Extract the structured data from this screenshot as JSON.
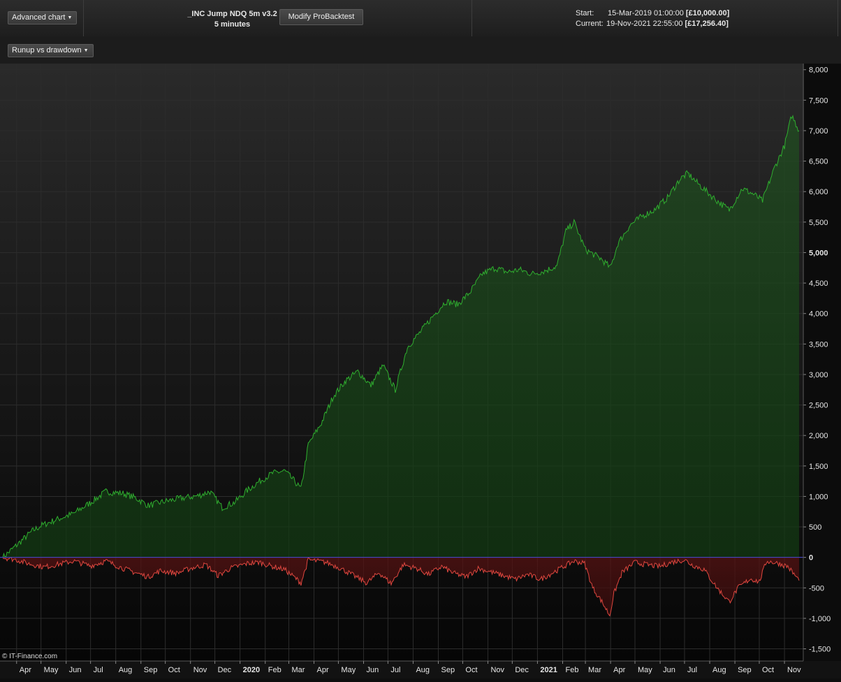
{
  "toolbar": {
    "advanced_chart_label": "Advanced chart",
    "strategy_name": "_INC Jump NDQ 5m v3.2",
    "timeframe": "5 minutes",
    "modify_button": "Modify ProBacktest",
    "start_label": "Start:",
    "start_datetime": "15-Mar-2019 01:00:00",
    "start_capital": "[£10,000.00]",
    "current_label": "Current:",
    "current_datetime": "19-Nov-2021 22:55:00",
    "current_capital": "[£17,256.40]",
    "view_selector": "Runup vs drawdown"
  },
  "footer": {
    "credit": "© IT-Finance.com"
  },
  "colors": {
    "runup": "#2fae2f",
    "drawdown": "#e0473f",
    "zero_line": "#4a4ad8",
    "grid": "#2c2c2c"
  },
  "chart_data": {
    "type": "area",
    "title": "",
    "ylim": [
      -1700,
      8100
    ],
    "y_ticks": [
      "8,000",
      "7,500",
      "7,000",
      "6,500",
      "6,000",
      "5,500",
      "5,000",
      "4,500",
      "4,000",
      "3,500",
      "3,000",
      "2,500",
      "2,000",
      "1,500",
      "1,000",
      "500",
      "0",
      "-500",
      "-1,000",
      "-1,500"
    ],
    "x_ticks": [
      "Apr",
      "May",
      "Jun",
      "Jul",
      "Aug",
      "Sep",
      "Oct",
      "Nov",
      "Dec",
      "2020",
      "Feb",
      "Mar",
      "Apr",
      "May",
      "Jun",
      "Jul",
      "Aug",
      "Sep",
      "Oct",
      "Nov",
      "Dec",
      "2021",
      "Feb",
      "Mar",
      "Apr",
      "May",
      "Jun",
      "Jul",
      "Aug",
      "Sep",
      "Oct",
      "Nov"
    ],
    "x_ticks_bold": [
      "2020",
      "2021"
    ],
    "x_range": [
      "2019-03-15",
      "2021-11-19"
    ],
    "series": [
      {
        "name": "Runup",
        "x": [
          "2019-03-15",
          "2019-04-01",
          "2019-04-20",
          "2019-05-01",
          "2019-05-20",
          "2019-06-10",
          "2019-07-01",
          "2019-07-20",
          "2019-08-10",
          "2019-08-25",
          "2019-09-10",
          "2019-10-01",
          "2019-10-20",
          "2019-11-10",
          "2019-11-25",
          "2019-12-10",
          "2019-12-25",
          "2020-01-10",
          "2020-01-25",
          "2020-02-10",
          "2020-02-25",
          "2020-03-10",
          "2020-03-16",
          "2020-03-25",
          "2020-04-10",
          "2020-04-25",
          "2020-05-10",
          "2020-05-25",
          "2020-06-10",
          "2020-06-25",
          "2020-07-10",
          "2020-07-25",
          "2020-08-10",
          "2020-08-25",
          "2020-09-10",
          "2020-09-25",
          "2020-10-10",
          "2020-10-25",
          "2020-11-10",
          "2020-11-25",
          "2020-12-10",
          "2020-12-25",
          "2021-01-10",
          "2021-01-25",
          "2021-02-05",
          "2021-02-15",
          "2021-03-01",
          "2021-03-20",
          "2021-04-01",
          "2021-04-10",
          "2021-04-25",
          "2021-05-10",
          "2021-05-25",
          "2021-06-10",
          "2021-06-25",
          "2021-07-05",
          "2021-07-20",
          "2021-08-10",
          "2021-08-25",
          "2021-09-10",
          "2021-09-25",
          "2021-10-05",
          "2021-10-20",
          "2021-11-01",
          "2021-11-10",
          "2021-11-19"
        ],
        "values": [
          0,
          200,
          430,
          520,
          620,
          720,
          900,
          1080,
          1050,
          980,
          850,
          920,
          970,
          1010,
          1080,
          820,
          900,
          1100,
          1250,
          1380,
          1420,
          1220,
          1120,
          1850,
          2200,
          2650,
          2900,
          3050,
          2820,
          3150,
          2750,
          3450,
          3700,
          3950,
          4200,
          4150,
          4350,
          4650,
          4750,
          4680,
          4720,
          4650,
          4700,
          4780,
          5350,
          5500,
          5050,
          4900,
          4750,
          5150,
          5450,
          5600,
          5700,
          5900,
          6200,
          6300,
          6100,
          5850,
          5700,
          6050,
          5950,
          5850,
          6400,
          6750,
          7250,
          7000
        ]
      },
      {
        "name": "Drawdown",
        "x": [
          "2019-03-15",
          "2019-04-01",
          "2019-04-15",
          "2019-05-05",
          "2019-05-20",
          "2019-06-10",
          "2019-07-01",
          "2019-07-20",
          "2019-08-10",
          "2019-08-25",
          "2019-09-10",
          "2019-09-25",
          "2019-10-15",
          "2019-11-01",
          "2019-11-20",
          "2019-12-05",
          "2019-12-20",
          "2020-01-10",
          "2020-01-25",
          "2020-02-10",
          "2020-02-25",
          "2020-03-10",
          "2020-03-16",
          "2020-03-25",
          "2020-04-15",
          "2020-05-01",
          "2020-05-20",
          "2020-06-05",
          "2020-06-20",
          "2020-07-05",
          "2020-07-20",
          "2020-08-05",
          "2020-08-20",
          "2020-09-05",
          "2020-09-20",
          "2020-10-05",
          "2020-10-20",
          "2020-11-05",
          "2020-11-20",
          "2020-12-05",
          "2020-12-20",
          "2021-01-05",
          "2021-01-20",
          "2021-02-01",
          "2021-02-15",
          "2021-02-28",
          "2021-03-10",
          "2021-03-20",
          "2021-03-31",
          "2021-04-05",
          "2021-04-15",
          "2021-05-01",
          "2021-05-15",
          "2021-06-01",
          "2021-06-15",
          "2021-07-01",
          "2021-07-10",
          "2021-07-25",
          "2021-08-10",
          "2021-08-25",
          "2021-09-05",
          "2021-09-20",
          "2021-10-01",
          "2021-10-10",
          "2021-10-25",
          "2021-11-05",
          "2021-11-19"
        ],
        "values": [
          0,
          -40,
          -100,
          -160,
          -120,
          -60,
          -140,
          -60,
          -180,
          -250,
          -320,
          -220,
          -260,
          -180,
          -120,
          -300,
          -180,
          -100,
          -80,
          -150,
          -200,
          -350,
          -420,
          -40,
          -80,
          -160,
          -300,
          -420,
          -250,
          -430,
          -120,
          -180,
          -280,
          -150,
          -260,
          -320,
          -180,
          -240,
          -300,
          -360,
          -280,
          -360,
          -250,
          -160,
          -60,
          -100,
          -500,
          -700,
          -950,
          -600,
          -250,
          -80,
          -120,
          -150,
          -80,
          -40,
          -120,
          -200,
          -500,
          -730,
          -500,
          -350,
          -400,
          -60,
          -100,
          -150,
          -380
        ]
      }
    ]
  }
}
